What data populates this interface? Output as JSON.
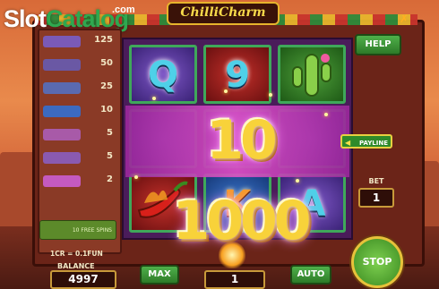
{
  "watermark": {
    "part1": "Slot",
    "part2": "Catalog",
    "part3": ".com"
  },
  "game": {
    "logo": "ChilliCharm"
  },
  "paytable": {
    "values": [
      "125",
      "50",
      "25",
      "10",
      "5",
      "5",
      "2"
    ],
    "scatter_text": "10 FREE SPINS"
  },
  "reels": {
    "row1": [
      {
        "symbol": "Q",
        "bg": "purple"
      },
      {
        "symbol": "9",
        "bg": "red"
      },
      {
        "symbol": "cactus",
        "bg": "green"
      }
    ],
    "row3": [
      {
        "symbol": "chilli",
        "bg": "red"
      },
      {
        "symbol": "K",
        "bg": "blue"
      },
      {
        "symbol": "A",
        "bg": "purple"
      }
    ]
  },
  "win": {
    "amount": "10 1000"
  },
  "controls": {
    "help": "HELP",
    "payline": "PAYLINE",
    "bet_label": "BET",
    "bet_value": "1",
    "stop": "STOP",
    "max": "MAX",
    "auto": "AUTO",
    "win_value": "1",
    "close": "✗"
  },
  "footer": {
    "credit_rate": "1CR = 0.1FUN",
    "balance_label": "BALANCE",
    "balance_value": "4997"
  },
  "icons": [
    "close-icon",
    "pepper-icon",
    "cactus-icon",
    "payline-arrow-icon",
    "fire-icon"
  ],
  "colors": {
    "reel_border": "#3fa85a",
    "button_green": "#3f9a3a",
    "frame": "#6b2418",
    "win_gold": "#f8d23a"
  }
}
